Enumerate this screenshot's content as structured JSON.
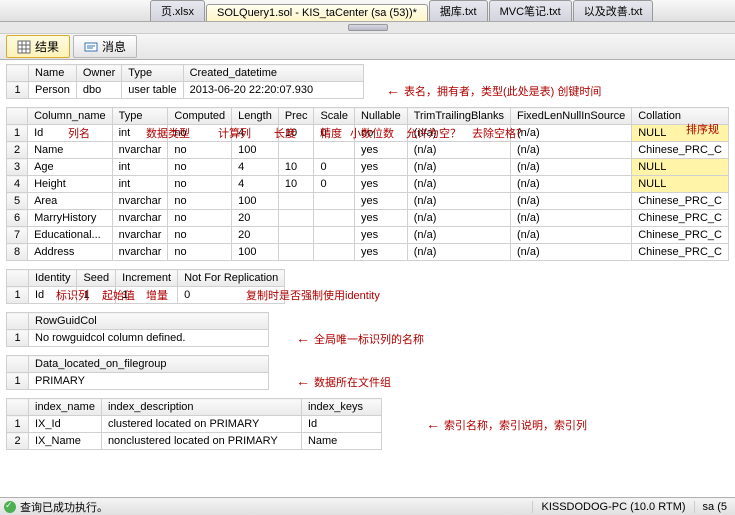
{
  "tabs": {
    "t1": "页.xlsx",
    "t2": "SOLQuery1.sol - KIS_taCenter (sa (53))*",
    "t3": "据库.txt",
    "t4": "MVC笔记.txt",
    "t5": "以及改善.txt"
  },
  "innerTabs": {
    "results": "结果",
    "messages": "消息"
  },
  "tbl1": {
    "h": {
      "name": "Name",
      "owner": "Owner",
      "type": "Type",
      "created": "Created_datetime"
    },
    "r1": {
      "n": "1",
      "name": "Person",
      "owner": "dbo",
      "type": "user table",
      "created": "2013-06-20 22:20:07.930"
    },
    "anno": "表名，拥有者，类型(此处是表) 创键时间"
  },
  "tbl2": {
    "h": {
      "col": "Column_name",
      "type": "Type",
      "comp": "Computed",
      "len": "Length",
      "prec": "Prec",
      "scale": "Scale",
      "null": "Nullable",
      "trim": "TrimTrailingBlanks",
      "fixed": "FixedLenNullInSource",
      "coll": "Collation"
    },
    "rows": [
      {
        "n": "1",
        "col": "Id",
        "type": "int",
        "comp": "no",
        "len": "4",
        "prec": "10",
        "scale": "0",
        "null": "no",
        "trim": "(n/a)",
        "fixed": "(n/a)",
        "coll": "NULL"
      },
      {
        "n": "2",
        "col": "Name",
        "type": "nvarchar",
        "comp": "no",
        "len": "100",
        "prec": "",
        "scale": "",
        "null": "yes",
        "trim": "(n/a)",
        "fixed": "(n/a)",
        "coll": "Chinese_PRC_C"
      },
      {
        "n": "3",
        "col": "Age",
        "type": "int",
        "comp": "no",
        "len": "4",
        "prec": "10",
        "scale": "0",
        "null": "yes",
        "trim": "(n/a)",
        "fixed": "(n/a)",
        "coll": "NULL"
      },
      {
        "n": "4",
        "col": "Height",
        "type": "int",
        "comp": "no",
        "len": "4",
        "prec": "10",
        "scale": "0",
        "null": "yes",
        "trim": "(n/a)",
        "fixed": "(n/a)",
        "coll": "NULL"
      },
      {
        "n": "5",
        "col": "Area",
        "type": "nvarchar",
        "comp": "no",
        "len": "100",
        "prec": "",
        "scale": "",
        "null": "yes",
        "trim": "(n/a)",
        "fixed": "(n/a)",
        "coll": "Chinese_PRC_C"
      },
      {
        "n": "6",
        "col": "MarryHistory",
        "type": "nvarchar",
        "comp": "no",
        "len": "20",
        "prec": "",
        "scale": "",
        "null": "yes",
        "trim": "(n/a)",
        "fixed": "(n/a)",
        "coll": "Chinese_PRC_C"
      },
      {
        "n": "7",
        "col": "Educational...",
        "type": "nvarchar",
        "comp": "no",
        "len": "20",
        "prec": "",
        "scale": "",
        "null": "yes",
        "trim": "(n/a)",
        "fixed": "(n/a)",
        "coll": "Chinese_PRC_C"
      },
      {
        "n": "8",
        "col": "Address",
        "type": "nvarchar",
        "comp": "no",
        "len": "100",
        "prec": "",
        "scale": "",
        "null": "yes",
        "trim": "(n/a)",
        "fixed": "(n/a)",
        "coll": "Chinese_PRC_C"
      }
    ],
    "anno": {
      "colname": "列名",
      "datatype": "数据类型",
      "computed": "计算列",
      "length": "长度",
      "prec": "精度",
      "scale": "小数位数",
      "nullable": "允许为空？",
      "trim": "去除空格？",
      "coll": "排序规"
    }
  },
  "tbl3": {
    "h": {
      "id": "Identity",
      "seed": "Seed",
      "inc": "Increment",
      "nfr": "Not For Replication"
    },
    "r": {
      "n": "1",
      "id": "Id",
      "seed": "1",
      "inc": "1",
      "nfr": "0"
    },
    "anno": {
      "id": "标识列",
      "seed": "起始值",
      "inc": "增量",
      "nfr": "复制时是否强制使用identity"
    }
  },
  "tbl4": {
    "h": "RowGuidCol",
    "r": {
      "n": "1",
      "v": "No rowguidcol column defined."
    },
    "anno": "全局唯一标识列的名称"
  },
  "tbl5": {
    "h": "Data_located_on_filegroup",
    "r": {
      "n": "1",
      "v": "PRIMARY"
    },
    "anno": "数据所在文件组"
  },
  "tbl6": {
    "h": {
      "name": "index_name",
      "desc": "index_description",
      "keys": "index_keys"
    },
    "rows": [
      {
        "n": "1",
        "name": "IX_Id",
        "desc": "clustered located on PRIMARY",
        "keys": "Id"
      },
      {
        "n": "2",
        "name": "IX_Name",
        "desc": "nonclustered located on PRIMARY",
        "keys": "Name"
      }
    ],
    "anno": "索引名称，索引说明，索引列"
  },
  "status": {
    "msg": "查询已成功执行。",
    "server": "KISSDODOG-PC (10.0 RTM)",
    "user": "sa (5"
  }
}
